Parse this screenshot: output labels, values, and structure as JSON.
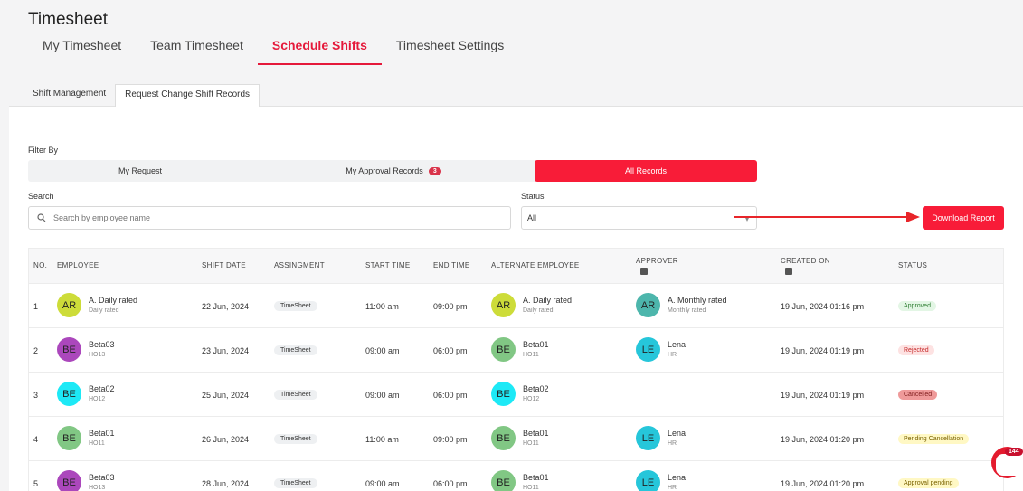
{
  "app_title": "Timesheet",
  "main_tabs": [
    "My Timesheet",
    "Team Timesheet",
    "Schedule Shifts",
    "Timesheet Settings"
  ],
  "sub_tabs": [
    "Shift Management",
    "Request Change Shift Records"
  ],
  "filter": {
    "label": "Filter By",
    "options": [
      "My Request",
      "My Approval Records",
      "All Records"
    ],
    "approval_count": "3"
  },
  "search": {
    "label": "Search",
    "placeholder": "Search by employee name"
  },
  "status_filter": {
    "label": "Status",
    "value": "All"
  },
  "download_label": "Download Report",
  "columns": [
    "NO.",
    "EMPLOYEE",
    "SHIFT DATE",
    "ASSINGMENT",
    "START TIME",
    "END TIME",
    "ALTERNATE EMPLOYEE",
    "APPROVER",
    "CREATED ON",
    "STATUS"
  ],
  "rows": [
    {
      "no": "1",
      "emp": {
        "initials": "AR",
        "name": "A. Daily rated",
        "sub": "Daily rated",
        "color": "#cddc39"
      },
      "date": "22 Jun, 2024",
      "assignment": "TimeSheet",
      "start": "11:00 am",
      "end": "09:00 pm",
      "alt": {
        "initials": "AR",
        "name": "A. Daily rated",
        "sub": "Daily rated",
        "color": "#cddc39"
      },
      "approver": {
        "initials": "AR",
        "name": "A. Monthly rated",
        "sub": "Monthly rated",
        "color": "#4db6ac"
      },
      "created": "19 Jun, 2024 01:16 pm",
      "status": "Approved",
      "status_bg": "#e3f6e5",
      "status_fg": "#2e7d32"
    },
    {
      "no": "2",
      "emp": {
        "initials": "BE",
        "name": "Beta03",
        "sub": "HO13",
        "color": "#ab47bc"
      },
      "date": "23 Jun, 2024",
      "assignment": "TimeSheet",
      "start": "09:00 am",
      "end": "06:00 pm",
      "alt": {
        "initials": "BE",
        "name": "Beta01",
        "sub": "HO11",
        "color": "#81c784"
      },
      "approver": {
        "initials": "LE",
        "name": "Lena",
        "sub": "HR",
        "color": "#26c6da"
      },
      "created": "19 Jun, 2024 01:19 pm",
      "status": "Rejected",
      "status_bg": "#fde2e2",
      "status_fg": "#c62828"
    },
    {
      "no": "3",
      "emp": {
        "initials": "BE",
        "name": "Beta02",
        "sub": "HO12",
        "color": "#1de9f6"
      },
      "date": "25 Jun, 2024",
      "assignment": "TimeSheet",
      "start": "09:00 am",
      "end": "06:00 pm",
      "alt": {
        "initials": "BE",
        "name": "Beta02",
        "sub": "HO12",
        "color": "#1de9f6"
      },
      "approver": null,
      "created": "19 Jun, 2024 01:19 pm",
      "status": "Cancelled",
      "status_bg": "#ef9a9a",
      "status_fg": "#7f1d1d"
    },
    {
      "no": "4",
      "emp": {
        "initials": "BE",
        "name": "Beta01",
        "sub": "HO11",
        "color": "#81c784"
      },
      "date": "26 Jun, 2024",
      "assignment": "TimeSheet",
      "start": "11:00 am",
      "end": "09:00 pm",
      "alt": {
        "initials": "BE",
        "name": "Beta01",
        "sub": "HO11",
        "color": "#81c784"
      },
      "approver": {
        "initials": "LE",
        "name": "Lena",
        "sub": "HR",
        "color": "#26c6da"
      },
      "created": "19 Jun, 2024 01:20 pm",
      "status": "Pending Cancellation",
      "status_bg": "#fff8c4",
      "status_fg": "#7a6200"
    },
    {
      "no": "5",
      "emp": {
        "initials": "BE",
        "name": "Beta03",
        "sub": "HO13",
        "color": "#ab47bc"
      },
      "date": "28 Jun, 2024",
      "assignment": "TimeSheet",
      "start": "09:00 am",
      "end": "06:00 pm",
      "alt": {
        "initials": "BE",
        "name": "Beta01",
        "sub": "HO11",
        "color": "#81c784"
      },
      "approver": {
        "initials": "LE",
        "name": "Lena",
        "sub": "HR",
        "color": "#26c6da"
      },
      "created": "19 Jun, 2024 01:20 pm",
      "status": "Approval pending",
      "status_bg": "#fff8c4",
      "status_fg": "#7a6200"
    }
  ],
  "notification_count": "144"
}
